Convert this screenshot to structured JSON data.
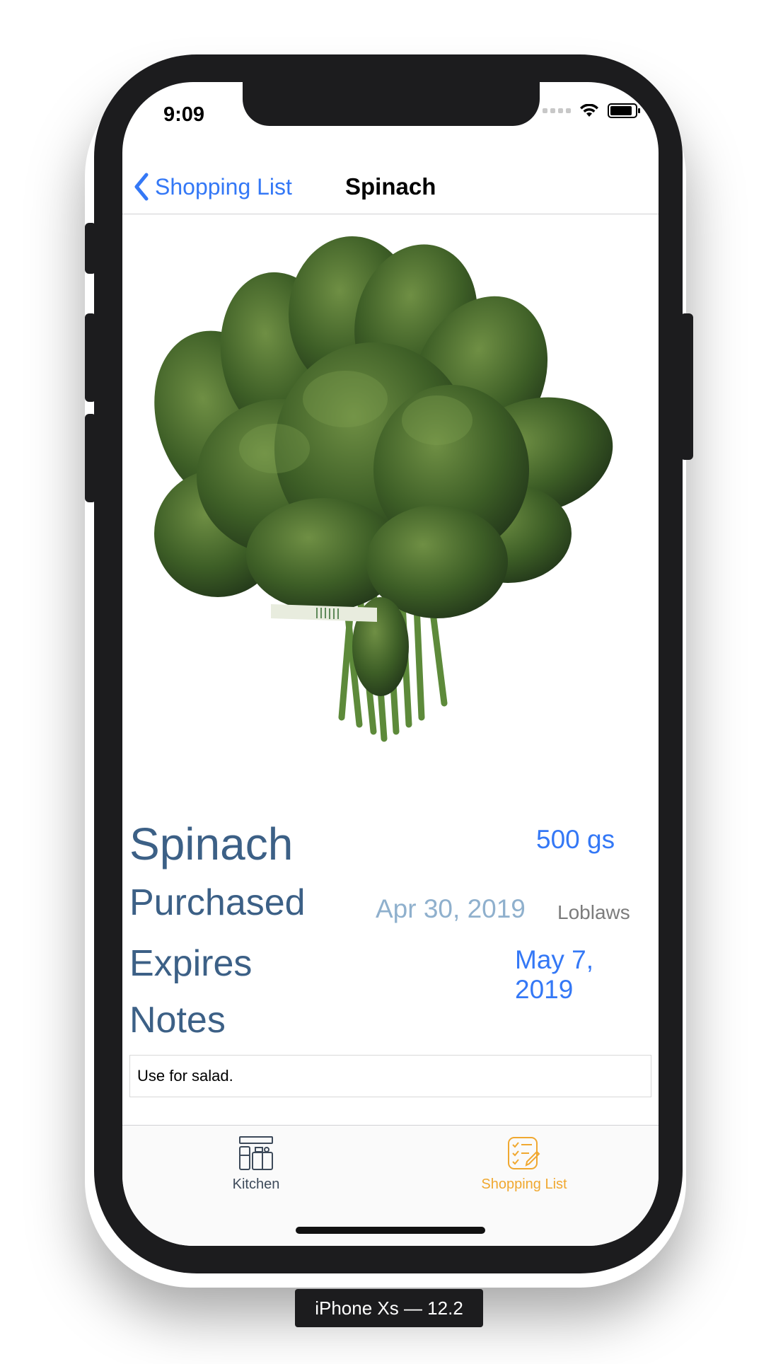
{
  "status_bar": {
    "time": "9:09"
  },
  "nav": {
    "back_label": "Shopping List",
    "title": "Spinach"
  },
  "item": {
    "name": "Spinach",
    "quantity": "500 gs",
    "purchased_label": "Purchased",
    "purchased_date": "Apr 30, 2019",
    "store": "Loblaws",
    "expires_label": "Expires",
    "expires_date": "May 7, 2019",
    "notes_label": "Notes",
    "notes_text": "Use for salad."
  },
  "tabbar": {
    "tabs": [
      {
        "label": "Kitchen",
        "icon": "kitchen-icon",
        "selected": false
      },
      {
        "label": "Shopping List",
        "icon": "shopping-list-icon",
        "selected": true
      }
    ]
  },
  "simulator": {
    "device_label": "iPhone Xs — 12.2"
  },
  "colors": {
    "accent": "#3478f6",
    "label": "#3c6086",
    "tab_selected": "#f0a830",
    "tab_normal": "#3d4a5a"
  },
  "photo": {
    "subject": "spinach-bunch-photo"
  }
}
